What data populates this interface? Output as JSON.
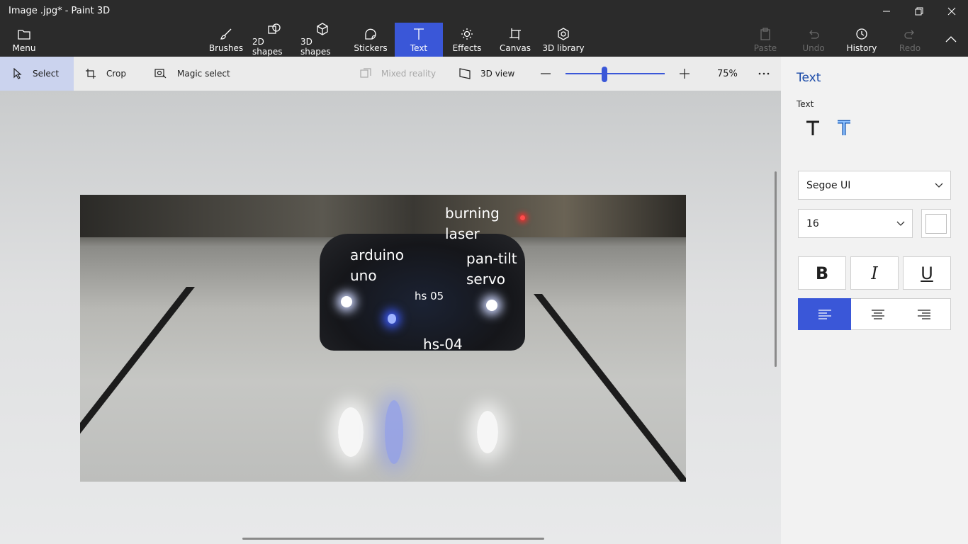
{
  "window": {
    "title": "Image .jpg* - Paint 3D"
  },
  "ribbon": {
    "menu": "Menu",
    "brushes": "Brushes",
    "shapes2d": "2D shapes",
    "shapes3d": "3D shapes",
    "stickers": "Stickers",
    "text": "Text",
    "effects": "Effects",
    "canvas": "Canvas",
    "library3d": "3D library",
    "paste": "Paste",
    "undo": "Undo",
    "history": "History",
    "redo": "Redo"
  },
  "toolbar": {
    "select": "Select",
    "crop": "Crop",
    "magic_select": "Magic select",
    "mixed_reality": "Mixed reality",
    "view3d": "3D view",
    "zoom": "75%",
    "zoom_level": 0.39
  },
  "photo_labels": {
    "burning_laser": "burning\nlaser",
    "arduino_uno": "arduino\nuno",
    "pan_tilt_servo": "pan-tilt\nservo",
    "hs05": "hs 05",
    "hs04": "hs-04"
  },
  "panel": {
    "title": "Text",
    "text_label": "Text",
    "font": "Segoe UI",
    "size": "16",
    "color": "#ffffff",
    "bold": "B",
    "italic": "I",
    "underline": "U"
  },
  "colors": {
    "accent": "#3a57d8",
    "ribbon": "#2b2b2b",
    "panel": "#f2f2f2"
  }
}
